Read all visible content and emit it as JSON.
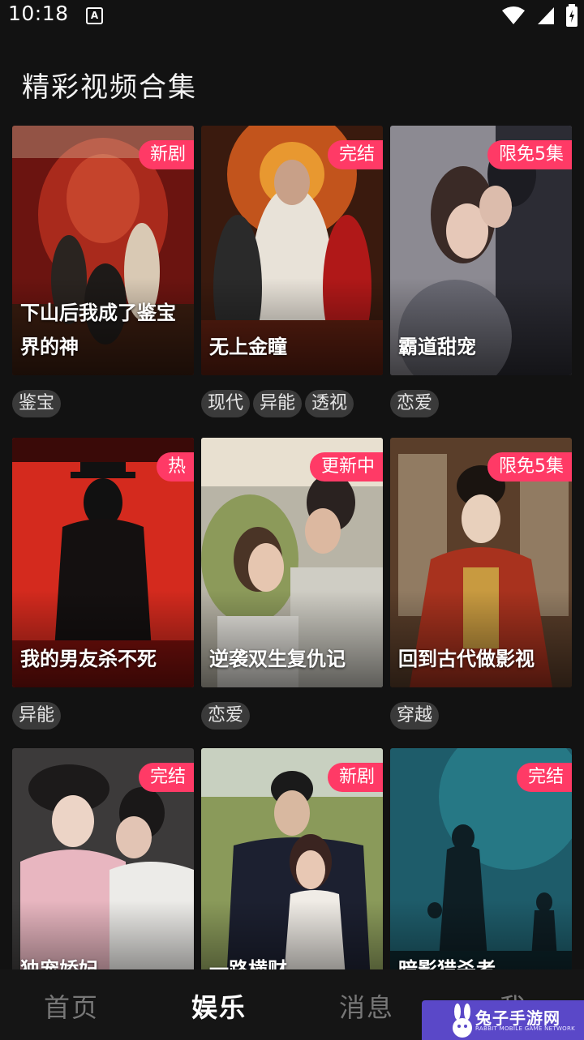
{
  "status_bar": {
    "time": "10:18",
    "notification_label": "A"
  },
  "section": {
    "title": "精彩视频合集"
  },
  "cards": [
    {
      "title": "下山后我成了鉴宝界的神",
      "badge": "新剧",
      "tags": [
        "鉴宝"
      ]
    },
    {
      "title": "无上金瞳",
      "badge": "完结",
      "tags": [
        "现代",
        "异能",
        "透视"
      ]
    },
    {
      "title": "霸道甜宠",
      "badge": "限免5集",
      "tags": [
        "恋爱"
      ]
    },
    {
      "title": "我的男友杀不死",
      "badge": "热",
      "tags": [
        "异能"
      ]
    },
    {
      "title": "逆袭双生复仇记",
      "badge": "更新中",
      "tags": [
        "恋爱"
      ]
    },
    {
      "title": "回到古代做影视",
      "badge": "限免5集",
      "tags": [
        "穿越"
      ]
    },
    {
      "title": "独宠娇妃",
      "badge": "完结",
      "tags": []
    },
    {
      "title": "一路横财",
      "badge": "新剧",
      "tags": []
    },
    {
      "title": "暗影猎杀者",
      "badge": "完结",
      "tags": []
    }
  ],
  "tabs": [
    {
      "label": "首页",
      "active": false
    },
    {
      "label": "娱乐",
      "active": true
    },
    {
      "label": "消息",
      "active": false
    },
    {
      "label": "我",
      "active": false
    }
  ],
  "watermark": {
    "cn": "兔子手游网",
    "en": "RABBIT MOBILE GAME NETWORK"
  },
  "colors": {
    "badge": "#ff3a66",
    "background": "#121212",
    "tag_bg": "#3a3a3a",
    "watermark": "#5a48c8"
  }
}
